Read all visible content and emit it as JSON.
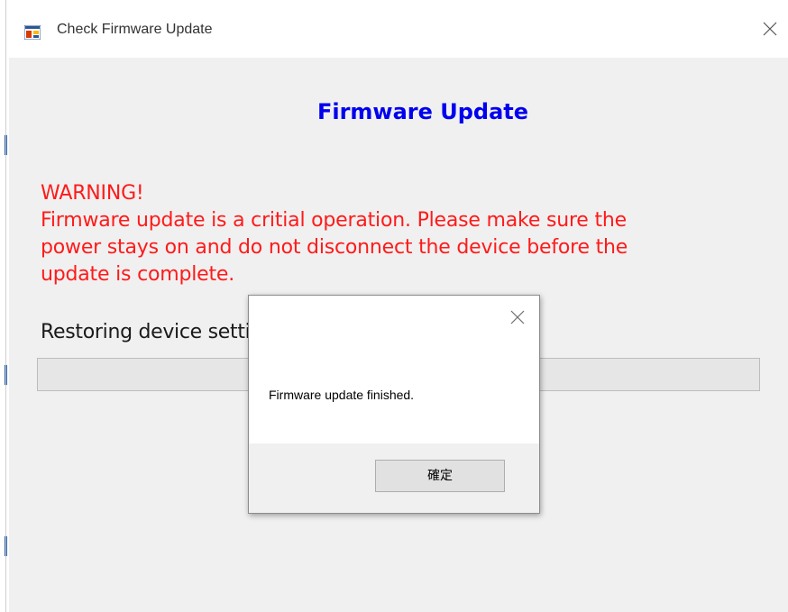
{
  "window": {
    "title": "Check Firmware Update",
    "icon": "app-window-icon",
    "close_icon": "close-icon"
  },
  "content": {
    "heading": "Firmware Update",
    "warning_lines": [
      "WARNING!",
      "Firmware update is a critial operation. Please make sure the",
      "power stays on and do not disconnect the device before the",
      "update is complete."
    ],
    "status_text": "Restoring device settings...",
    "progress_percent": 0
  },
  "dialog": {
    "message": "Firmware update finished.",
    "ok_label": "確定",
    "close_icon": "close-icon"
  },
  "colors": {
    "heading": "#0000ee",
    "warning": "#ff1a1a",
    "background": "#f0f0f0"
  }
}
